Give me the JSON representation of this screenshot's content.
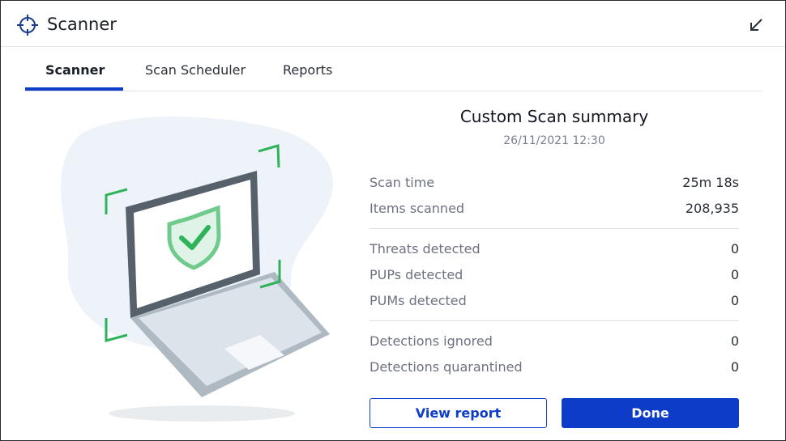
{
  "window": {
    "title": "Scanner"
  },
  "tabs": [
    {
      "label": "Scanner",
      "active": true
    },
    {
      "label": "Scan Scheduler",
      "active": false
    },
    {
      "label": "Reports",
      "active": false
    }
  ],
  "summary": {
    "title": "Custom Scan summary",
    "date": "26/11/2021 12:30",
    "groups": [
      [
        {
          "label": "Scan time",
          "value": "25m 18s"
        },
        {
          "label": "Items scanned",
          "value": "208,935"
        }
      ],
      [
        {
          "label": "Threats detected",
          "value": "0"
        },
        {
          "label": "PUPs detected",
          "value": "0"
        },
        {
          "label": "PUMs detected",
          "value": "0"
        }
      ],
      [
        {
          "label": "Detections ignored",
          "value": "0"
        },
        {
          "label": "Detections quarantined",
          "value": "0"
        }
      ]
    ]
  },
  "buttons": {
    "view_report": "View report",
    "done": "Done"
  },
  "icons": {
    "app": "crosshair-icon",
    "minimize": "minimize-arrow-icon",
    "illustration": "laptop-shield-check-icon"
  },
  "colors": {
    "accent": "#0c3cc8",
    "shield": "#2fb35a",
    "laptop": "#56616c"
  }
}
